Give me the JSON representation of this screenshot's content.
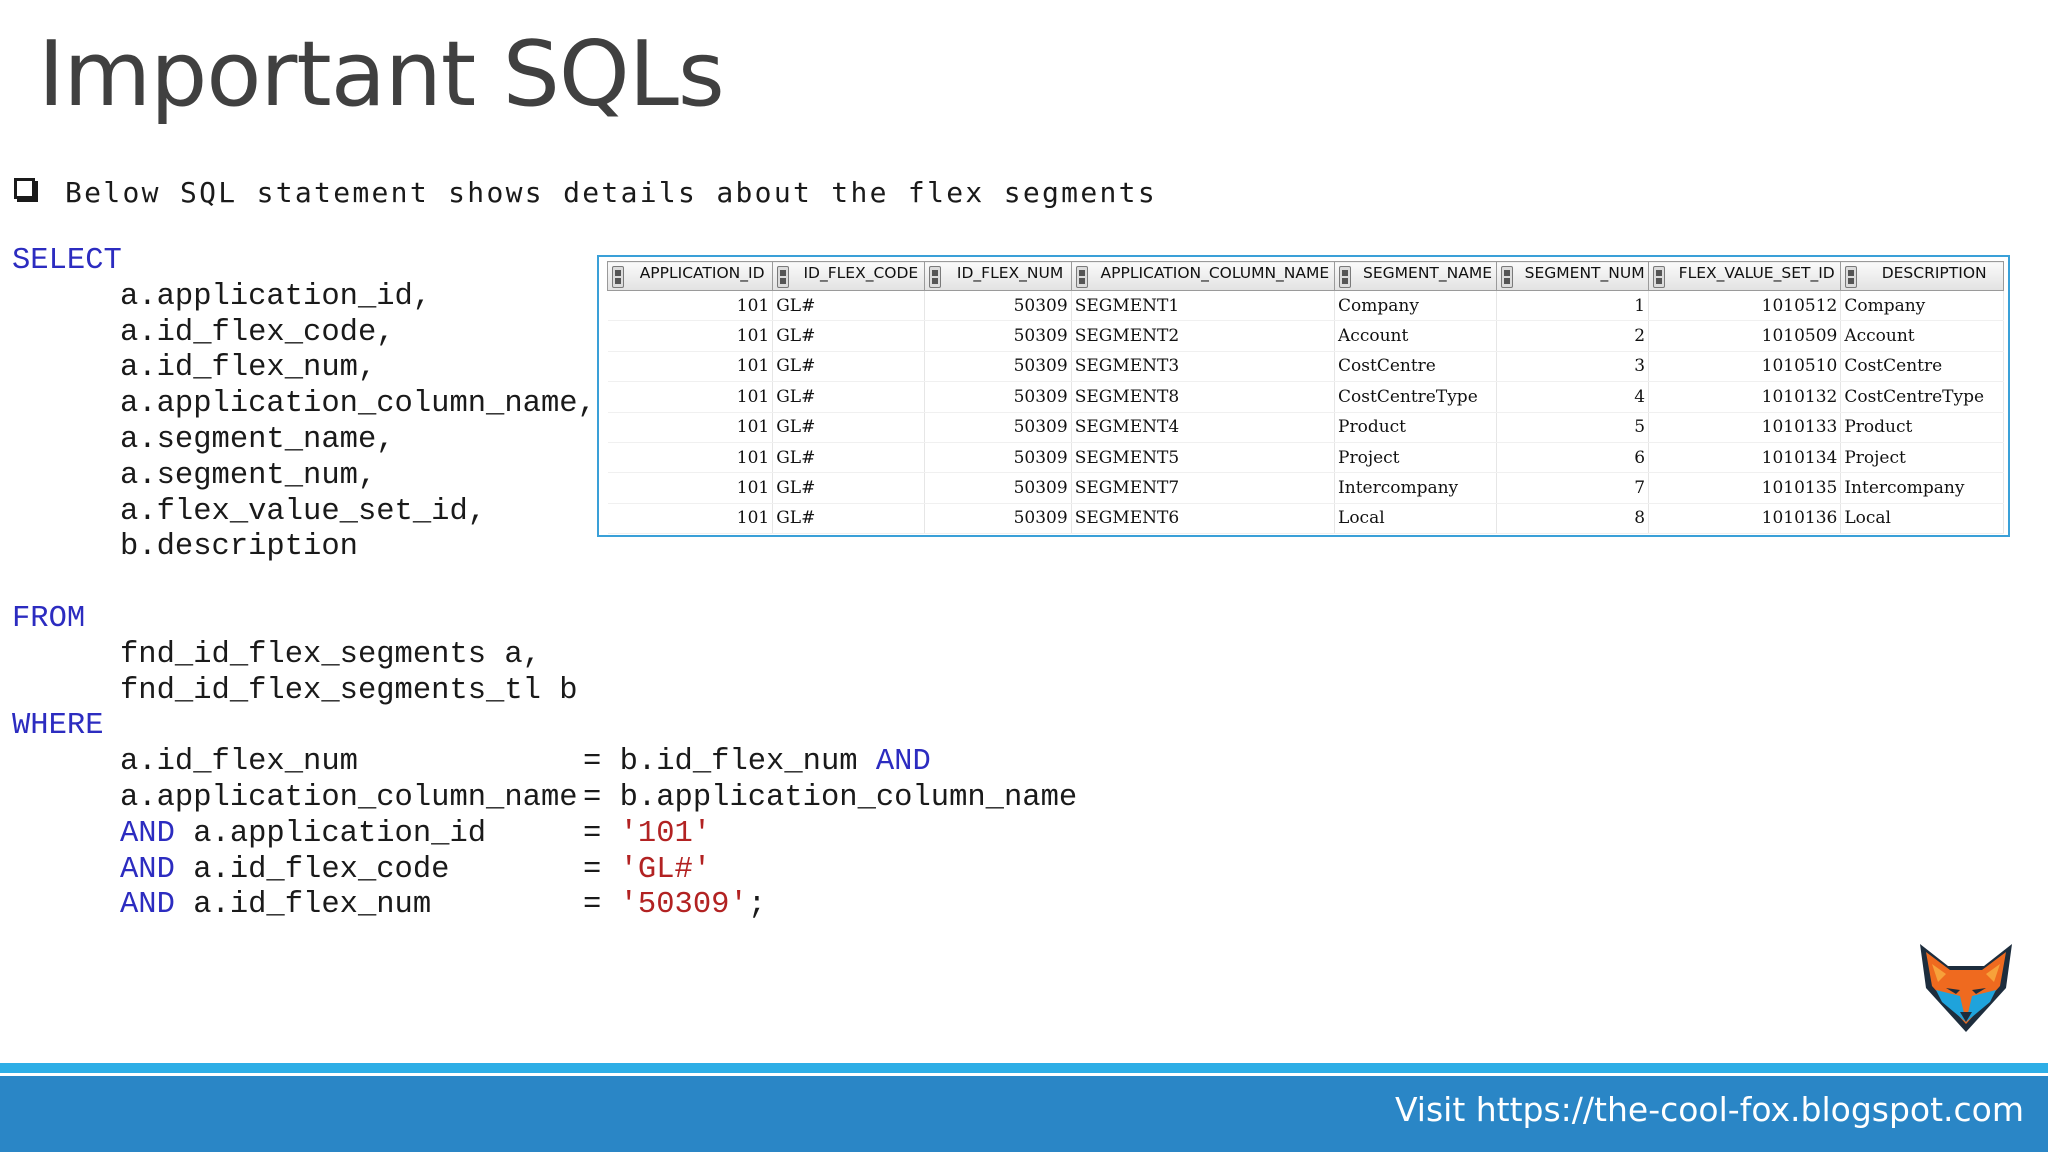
{
  "slide": {
    "title": "Important SQLs",
    "bullet": "Below SQL statement shows details about the flex segments",
    "footer": "Visit https://the-cool-fox.blogspot.com"
  },
  "sql": {
    "select_kw": "SELECT",
    "select_cols": [
      "a.application_id,",
      "a.id_flex_code,",
      "a.id_flex_num,",
      "a.application_column_name,",
      "a.segment_name,",
      "a.segment_num,",
      "a.flex_value_set_id,",
      "b.description"
    ],
    "from_kw": "FROM",
    "from_tables": [
      "fnd_id_flex_segments a,",
      "fnd_id_flex_segments_tl b"
    ],
    "where_kw": "WHERE",
    "conditions": [
      {
        "pre": "",
        "left": "a.id_flex_num",
        "op": "=",
        "right": "b.id_flex_num",
        "right_type": "plain",
        "post": " AND"
      },
      {
        "pre": "",
        "left": "a.application_column_name",
        "op": "=",
        "right": "b.application_column_name",
        "right_type": "plain",
        "post": ""
      },
      {
        "pre": "AND ",
        "left": "a.application_id",
        "op": "=",
        "right": "'101'",
        "right_type": "string",
        "post": ""
      },
      {
        "pre": "AND ",
        "left": "a.id_flex_code",
        "op": "=",
        "right": "'GL#'",
        "right_type": "string",
        "post": ""
      },
      {
        "pre": "AND ",
        "left": "a.id_flex_num",
        "op": "=",
        "right": "'50309'",
        "right_type": "string",
        "post": ";"
      }
    ]
  },
  "result_grid": {
    "columns": [
      {
        "label": "APPLICATION_ID",
        "align": "num"
      },
      {
        "label": "ID_FLEX_CODE",
        "align": "txt"
      },
      {
        "label": "ID_FLEX_NUM",
        "align": "num"
      },
      {
        "label": "APPLICATION_COLUMN_NAME",
        "align": "txt"
      },
      {
        "label": "SEGMENT_NAME",
        "align": "txt"
      },
      {
        "label": "SEGMENT_NUM",
        "align": "num"
      },
      {
        "label": "FLEX_VALUE_SET_ID",
        "align": "num"
      },
      {
        "label": "DESCRIPTION",
        "align": "txt"
      }
    ],
    "rows": [
      [
        "101",
        "GL#",
        "50309",
        "SEGMENT1",
        "Company",
        "1",
        "1010512",
        "Company"
      ],
      [
        "101",
        "GL#",
        "50309",
        "SEGMENT2",
        "Account",
        "2",
        "1010509",
        "Account"
      ],
      [
        "101",
        "GL#",
        "50309",
        "SEGMENT3",
        "CostCentre",
        "3",
        "1010510",
        "CostCentre"
      ],
      [
        "101",
        "GL#",
        "50309",
        "SEGMENT8",
        "CostCentreType",
        "4",
        "1010132",
        "CostCentreType"
      ],
      [
        "101",
        "GL#",
        "50309",
        "SEGMENT4",
        "Product",
        "5",
        "1010133",
        "Product"
      ],
      [
        "101",
        "GL#",
        "50309",
        "SEGMENT5",
        "Project",
        "6",
        "1010134",
        "Project"
      ],
      [
        "101",
        "GL#",
        "50309",
        "SEGMENT7",
        "Intercompany",
        "7",
        "1010135",
        "Intercompany"
      ],
      [
        "101",
        "GL#",
        "50309",
        "SEGMENT6",
        "Local",
        "8",
        "1010136",
        "Local"
      ]
    ]
  },
  "icons": {
    "bullet": "checkbox-bullet-icon",
    "logo": "fox-logo-icon",
    "sort": "sort-icon"
  },
  "colors": {
    "title": "#404040",
    "keyword": "#2c2cc0",
    "string": "#b22222",
    "footer_bg": "#2a86c6",
    "footer_accent": "#2eaee6",
    "grid_border": "#3aa0d8"
  }
}
